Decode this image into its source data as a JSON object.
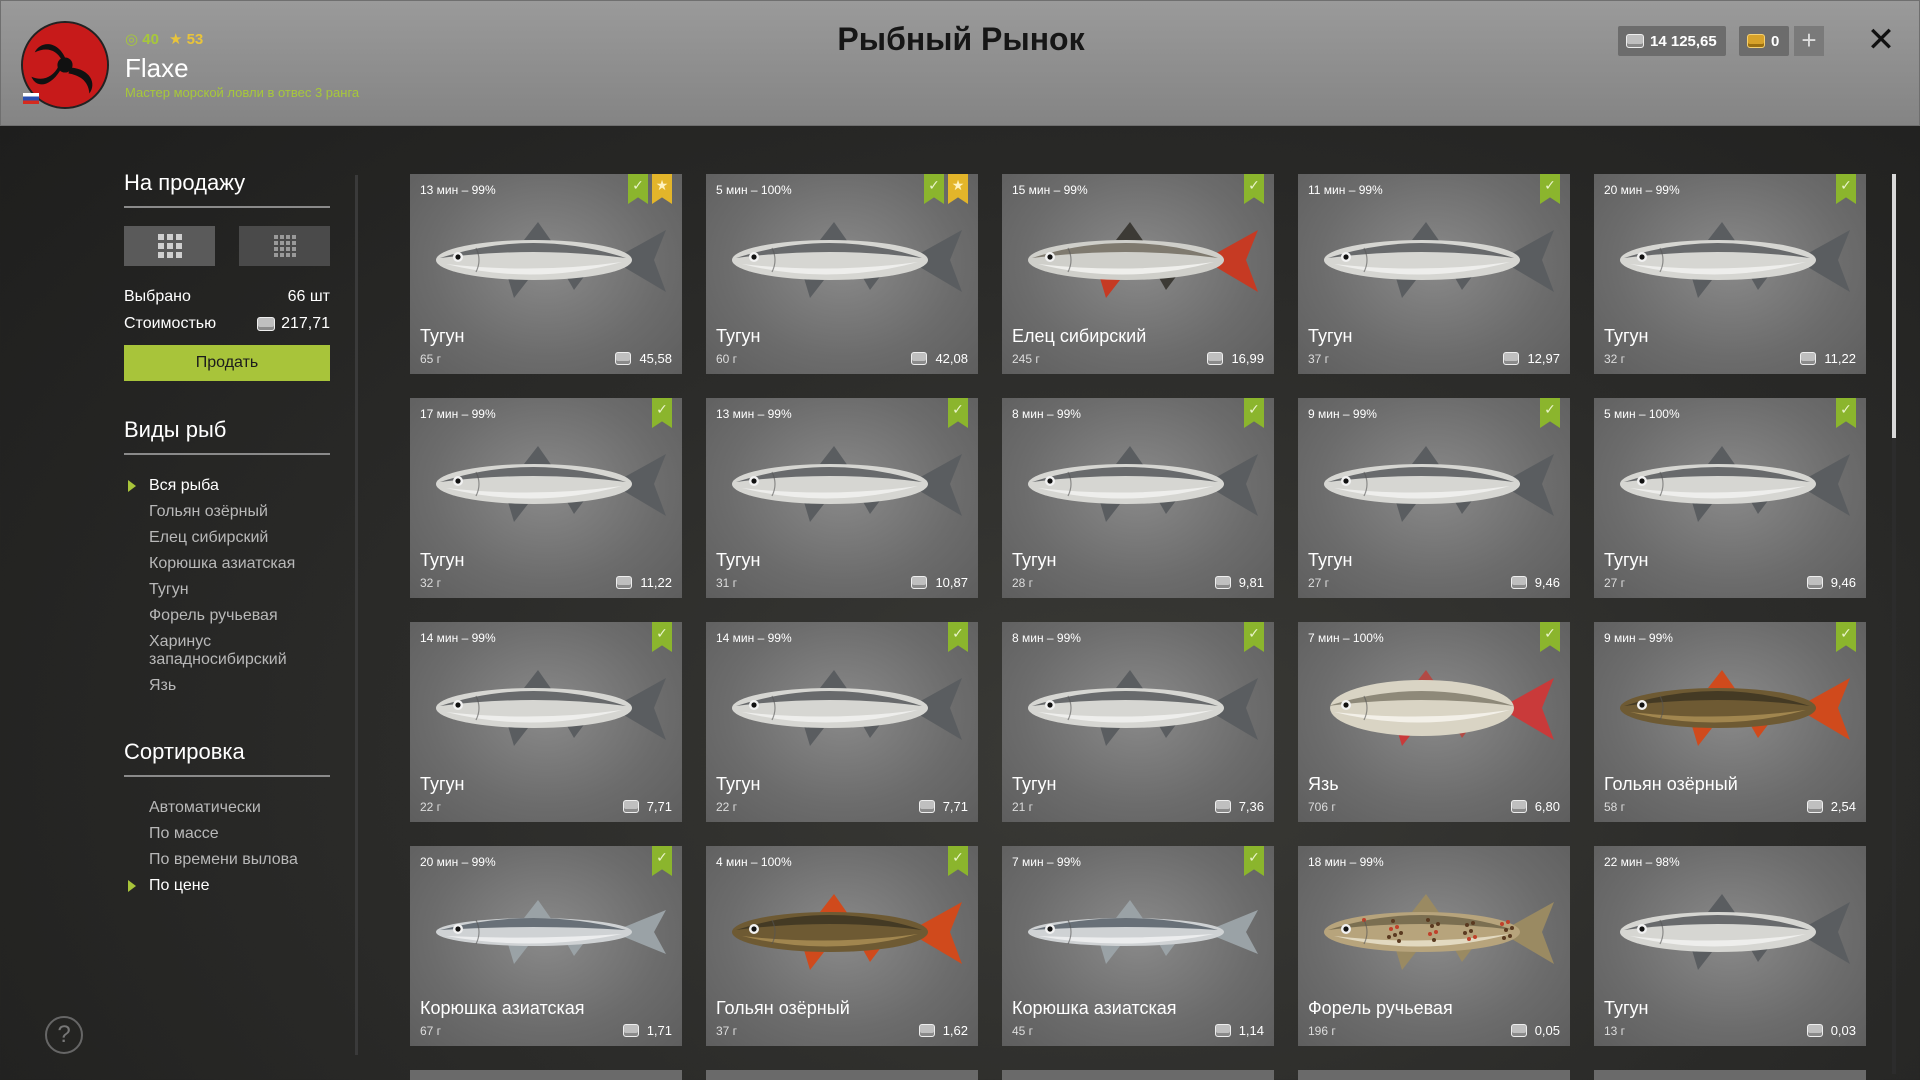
{
  "header": {
    "title": "Рыбный Рынок",
    "player": {
      "name": "Flaxe",
      "rank": "Мастер морской ловли в отвес 3 ранга",
      "level": "40",
      "stars": "53"
    },
    "silver": "14 125,65",
    "gold": "0",
    "add_label": "+",
    "close_label": "✕"
  },
  "sidebar": {
    "sale_title": "На продажу",
    "selected_label": "Выбрано",
    "selected_value": "66 шт",
    "cost_label": "Стоимостью",
    "cost_value": "217,71",
    "sell_label": "Продать",
    "species_title": "Виды рыб",
    "species": [
      "Вся рыба",
      "Гольян озёрный",
      "Елец сибирский",
      "Корюшка азиатская",
      "Тугун",
      "Форель ручьевая",
      "Харинус западносибирский",
      "Язь"
    ],
    "species_active": 0,
    "sort_title": "Сортировка",
    "sort": [
      "Автоматически",
      "По массе",
      "По времени вылова",
      "По цене"
    ],
    "sort_active": 3,
    "help_label": "?"
  },
  "fish": [
    {
      "time": "13 мин – 99%",
      "name": "Тугун",
      "weight": "65 г",
      "price": "45,58",
      "checked": true,
      "star": true,
      "kind": "tugun"
    },
    {
      "time": "5 мин – 100%",
      "name": "Тугун",
      "weight": "60 г",
      "price": "42,08",
      "checked": true,
      "star": true,
      "kind": "tugun"
    },
    {
      "time": "15 мин – 99%",
      "name": "Елец сибирский",
      "weight": "245 г",
      "price": "16,99",
      "checked": true,
      "star": false,
      "kind": "elets"
    },
    {
      "time": "11 мин – 99%",
      "name": "Тугун",
      "weight": "37 г",
      "price": "12,97",
      "checked": true,
      "star": false,
      "kind": "tugun"
    },
    {
      "time": "20 мин – 99%",
      "name": "Тугун",
      "weight": "32 г",
      "price": "11,22",
      "checked": true,
      "star": false,
      "kind": "tugun"
    },
    {
      "time": "17 мин – 99%",
      "name": "Тугун",
      "weight": "32 г",
      "price": "11,22",
      "checked": true,
      "star": false,
      "kind": "tugun"
    },
    {
      "time": "13 мин – 99%",
      "name": "Тугун",
      "weight": "31 г",
      "price": "10,87",
      "checked": true,
      "star": false,
      "kind": "tugun"
    },
    {
      "time": "8 мин – 99%",
      "name": "Тугун",
      "weight": "28 г",
      "price": "9,81",
      "checked": true,
      "star": false,
      "kind": "tugun"
    },
    {
      "time": "9 мин – 99%",
      "name": "Тугун",
      "weight": "27 г",
      "price": "9,46",
      "checked": true,
      "star": false,
      "kind": "tugun"
    },
    {
      "time": "5 мин – 100%",
      "name": "Тугун",
      "weight": "27 г",
      "price": "9,46",
      "checked": true,
      "star": false,
      "kind": "tugun"
    },
    {
      "time": "14 мин – 99%",
      "name": "Тугун",
      "weight": "22 г",
      "price": "7,71",
      "checked": true,
      "star": false,
      "kind": "tugun"
    },
    {
      "time": "14 мин – 99%",
      "name": "Тугун",
      "weight": "22 г",
      "price": "7,71",
      "checked": true,
      "star": false,
      "kind": "tugun"
    },
    {
      "time": "8 мин – 99%",
      "name": "Тугун",
      "weight": "21 г",
      "price": "7,36",
      "checked": true,
      "star": false,
      "kind": "tugun"
    },
    {
      "time": "7 мин – 100%",
      "name": "Язь",
      "weight": "706 г",
      "price": "6,80",
      "checked": true,
      "star": false,
      "kind": "yaz"
    },
    {
      "time": "9 мин – 99%",
      "name": "Гольян озёрный",
      "weight": "58 г",
      "price": "2,54",
      "checked": true,
      "star": false,
      "kind": "golyan"
    },
    {
      "time": "20 мин – 99%",
      "name": "Корюшка азиатская",
      "weight": "67 г",
      "price": "1,71",
      "checked": true,
      "star": false,
      "kind": "koryushka"
    },
    {
      "time": "4 мин – 100%",
      "name": "Гольян озёрный",
      "weight": "37 г",
      "price": "1,62",
      "checked": true,
      "star": false,
      "kind": "golyan"
    },
    {
      "time": "7 мин – 99%",
      "name": "Корюшка азиатская",
      "weight": "45 г",
      "price": "1,14",
      "checked": true,
      "star": false,
      "kind": "koryushka"
    },
    {
      "time": "18 мин – 99%",
      "name": "Форель ручьевая",
      "weight": "196 г",
      "price": "0,05",
      "checked": false,
      "star": false,
      "kind": "forel"
    },
    {
      "time": "22 мин – 98%",
      "name": "Тугун",
      "weight": "13 г",
      "price": "0,03",
      "checked": false,
      "star": false,
      "kind": "tugun"
    }
  ],
  "colors": {
    "accent": "#a8c43a",
    "bookmark_green": "#8bb52d",
    "bookmark_star": "#e3b52a"
  }
}
